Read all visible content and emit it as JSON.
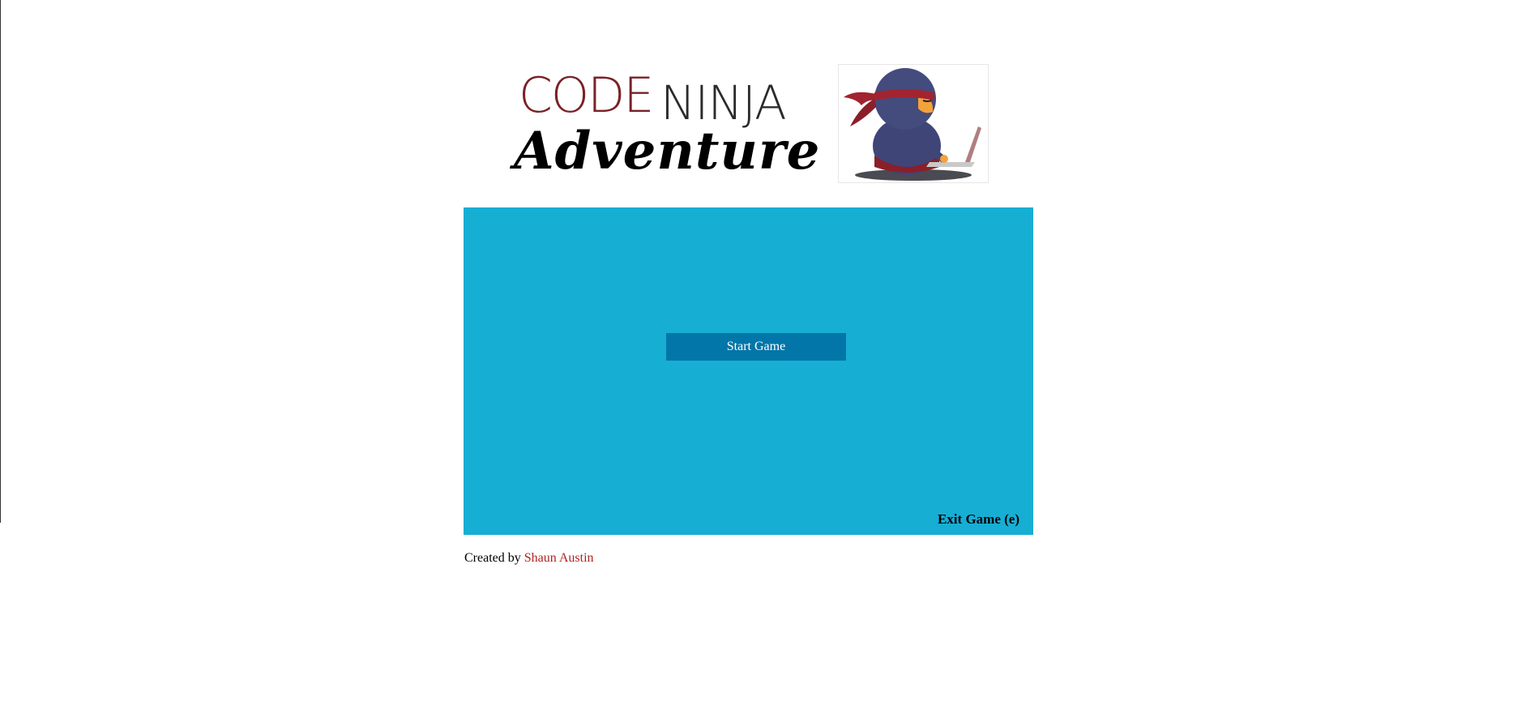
{
  "header": {
    "logo_code": "CODE",
    "logo_ninja": "NINJA",
    "logo_adventure": "Adventure",
    "mascot_icon": "ninja-with-laptop-icon"
  },
  "stage": {
    "background": "#17aed4",
    "start_label": "Start Game",
    "start_color": "#0276a8",
    "exit_label": "Exit Game (e)"
  },
  "footer": {
    "created_by": "Created by",
    "author": "Shaun Austin",
    "author_color": "#b22222"
  }
}
